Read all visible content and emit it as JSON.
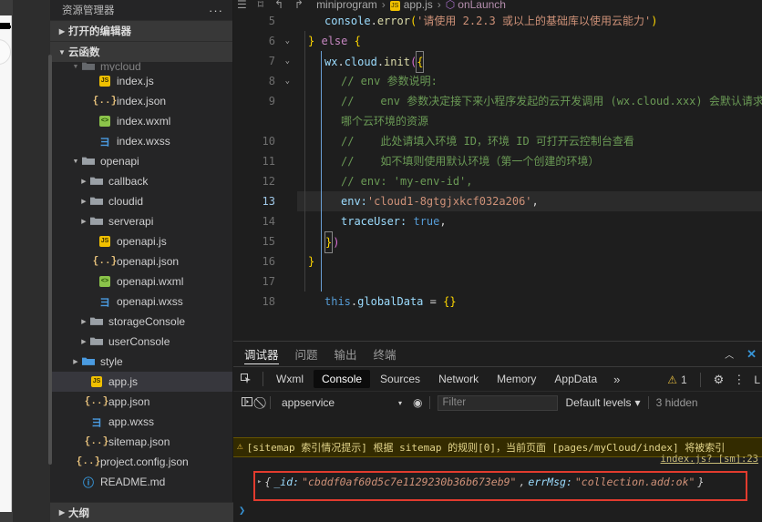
{
  "simulator": {
    "battery_icon": "battery-icon",
    "home_circle": "home-circle"
  },
  "sidebar": {
    "title": "资源管理器",
    "more_label": "···",
    "sections": [
      {
        "label": "打开的编辑器",
        "expanded": false
      },
      {
        "label": "云函数",
        "expanded": true
      }
    ],
    "outline_label": "大纲",
    "tree": [
      {
        "label": "mycloud",
        "icon": "folder-open-icon",
        "indent": 2,
        "arrow": "down",
        "type": "folder",
        "clipped": true
      },
      {
        "label": "index.js",
        "icon": "js-file-icon",
        "indent": 4,
        "arrow": "",
        "type": "file"
      },
      {
        "label": "index.json",
        "icon": "json-file-icon",
        "indent": 4,
        "arrow": "",
        "type": "file"
      },
      {
        "label": "index.wxml",
        "icon": "wxml-file-icon",
        "indent": 4,
        "arrow": "",
        "type": "file"
      },
      {
        "label": "index.wxss",
        "icon": "wxss-file-icon",
        "indent": 4,
        "arrow": "",
        "type": "file"
      },
      {
        "label": "openapi",
        "icon": "folder-open-icon",
        "indent": 2,
        "arrow": "down",
        "type": "folder"
      },
      {
        "label": "callback",
        "icon": "folder-icon",
        "indent": 3,
        "arrow": "right",
        "type": "folder"
      },
      {
        "label": "cloudid",
        "icon": "folder-icon",
        "indent": 3,
        "arrow": "right",
        "type": "folder"
      },
      {
        "label": "serverapi",
        "icon": "folder-icon",
        "indent": 3,
        "arrow": "right",
        "type": "folder"
      },
      {
        "label": "openapi.js",
        "icon": "js-file-icon",
        "indent": 4,
        "arrow": "",
        "type": "file"
      },
      {
        "label": "openapi.json",
        "icon": "json-file-icon",
        "indent": 4,
        "arrow": "",
        "type": "file"
      },
      {
        "label": "openapi.wxml",
        "icon": "wxml-file-icon",
        "indent": 4,
        "arrow": "",
        "type": "file"
      },
      {
        "label": "openapi.wxss",
        "icon": "wxss-file-icon",
        "indent": 4,
        "arrow": "",
        "type": "file"
      },
      {
        "label": "storageConsole",
        "icon": "folder-icon",
        "indent": 3,
        "arrow": "right",
        "type": "folder"
      },
      {
        "label": "userConsole",
        "icon": "folder-icon",
        "indent": 3,
        "arrow": "right",
        "type": "folder"
      },
      {
        "label": "style",
        "icon": "folder-blue-icon",
        "indent": 2,
        "arrow": "right",
        "type": "folder"
      },
      {
        "label": "app.js",
        "icon": "js-file-icon",
        "indent": 3,
        "arrow": "",
        "type": "file",
        "selected": true
      },
      {
        "label": "app.json",
        "icon": "json-file-icon",
        "indent": 3,
        "arrow": "",
        "type": "file"
      },
      {
        "label": "app.wxss",
        "icon": "wxss-file-icon",
        "indent": 3,
        "arrow": "",
        "type": "file"
      },
      {
        "label": "sitemap.json",
        "icon": "json-file-icon",
        "indent": 3,
        "arrow": "",
        "type": "file"
      },
      {
        "label": "project.config.json",
        "icon": "json-file-icon",
        "indent": 2,
        "arrow": "",
        "type": "file"
      },
      {
        "label": "README.md",
        "icon": "markdown-file-icon",
        "indent": 2,
        "arrow": "",
        "type": "file"
      }
    ]
  },
  "breadcrumb": {
    "part1": "miniprogram",
    "sep": "›",
    "part2": "app.js",
    "part3": "onLaunch",
    "icons": [
      "menu-icon",
      "bookmark-icon",
      "back-arrow-icon",
      "forward-arrow-icon"
    ]
  },
  "editor": {
    "lines": [
      {
        "num": "5",
        "fold": "",
        "active": false,
        "highlight": false
      },
      {
        "num": "6",
        "fold": "down",
        "active": false,
        "highlight": false
      },
      {
        "num": "7",
        "fold": "down",
        "active": false,
        "highlight": false
      },
      {
        "num": "8",
        "fold": "down",
        "active": false,
        "highlight": false
      },
      {
        "num": "9",
        "fold": "",
        "active": false,
        "highlight": false
      },
      {
        "num": "",
        "fold": "",
        "active": false,
        "highlight": false
      },
      {
        "num": "10",
        "fold": "",
        "active": false,
        "highlight": false
      },
      {
        "num": "11",
        "fold": "",
        "active": false,
        "highlight": false
      },
      {
        "num": "12",
        "fold": "",
        "active": false,
        "highlight": false
      },
      {
        "num": "13",
        "fold": "",
        "active": true,
        "highlight": true
      },
      {
        "num": "14",
        "fold": "",
        "active": false,
        "highlight": false
      },
      {
        "num": "15",
        "fold": "",
        "active": false,
        "highlight": false
      },
      {
        "num": "16",
        "fold": "",
        "active": false,
        "highlight": false
      },
      {
        "num": "17",
        "fold": "",
        "active": false,
        "highlight": false
      },
      {
        "num": "18",
        "fold": "",
        "active": false,
        "highlight": false
      }
    ],
    "code": {
      "l5_obj": "console",
      "l5_dot": ".",
      "l5_fn": "error",
      "l5_open": "(",
      "l5_str": "'请使用 2.2.3 或以上的基础库以使用云能力'",
      "l5_close": ")",
      "l6_brace": "}",
      "l6_else": "else",
      "l6_open": "{",
      "l7_wx": "wx",
      "l7_d1": ".",
      "l7_cloud": "cloud",
      "l7_d2": ".",
      "l7_init": "init",
      "l7_paren": "(",
      "l7_brace": "{",
      "l8_comment": "// env 参数说明:",
      "l9_comment": "//    env 参数决定接下来小程序发起的云开发调用 (wx.cloud.xxx) 会默认请求到",
      "l9_wrap": "哪个云环境的资源",
      "l10_comment": "//    此处请填入环境 ID，环境 ID 可打开云控制台查看",
      "l11_comment": "//    如不填则使用默认环境（第一个创建的环境）",
      "l12_comment": "// env: 'my-env-id',",
      "l13_key": "env:",
      "l13_str": "'cloud1-8gtgjxkcf032a206'",
      "l13_comma": ",",
      "l14_key": "traceUser:",
      "l14_val": "true",
      "l14_comma": ",",
      "l15_brace": "}",
      "l15_paren": ")",
      "l16_brace": "}",
      "l18_this": "this",
      "l18_dot": ".",
      "l18_prop": "globalData",
      "l18_eq": "=",
      "l18_obj": "{}"
    }
  },
  "panel": {
    "tabs": [
      {
        "label": "调试器",
        "active": true
      },
      {
        "label": "问题",
        "active": false
      },
      {
        "label": "输出",
        "active": false
      },
      {
        "label": "终端",
        "active": false
      }
    ],
    "collapse_icon": "chevron-up-icon",
    "close_icon": "close-icon",
    "devtools_tabs": [
      {
        "label": "Wxml",
        "active": false
      },
      {
        "label": "Console",
        "active": true
      },
      {
        "label": "Sources",
        "active": false
      },
      {
        "label": "Network",
        "active": false
      },
      {
        "label": "Memory",
        "active": false
      },
      {
        "label": "AppData",
        "active": false
      }
    ],
    "more_tabs_icon": "chevron-double-right-icon",
    "warning_count": "1",
    "settings_icon": "gear-icon",
    "kebab_icon": "kebab-menu-icon",
    "console_toolbar": {
      "sidebar_toggle_icon": "console-sidebar-icon",
      "clear_icon": "clear-console-icon",
      "context": "appservice",
      "context_caret": "▾",
      "eye_icon": "live-expression-icon",
      "filter_placeholder": "Filter",
      "levels_label": "Default levels",
      "levels_caret": "▾",
      "hidden_label": "3 hidden"
    },
    "console_messages": [
      {
        "type": "warning",
        "icon": "warning-triangle-icon",
        "text": "[sitemap 索引情况提示] 根据 sitemap 的规则[0]，当前页面 [pages/myCloud/index] 将被索引",
        "source": "index.js? [sm]:23"
      }
    ],
    "result": {
      "expander": "▸",
      "open_brace": "{",
      "key1": "_id:",
      "val1": "\"cbddf0af60d5c7e1129230b36b673eb9\"",
      "comma": ",",
      "key2": "errMsg:",
      "val2": "\"collection.add:ok\"",
      "close_brace": "}",
      "highlight_color": "#e23b2e"
    },
    "prompt_caret": "❯"
  },
  "colors": {
    "editor_bg": "#1e1e1e",
    "sidebar_bg": "#252526",
    "accent_blue": "#3794d6",
    "warning_yellow": "#e2b93d",
    "warning_bg": "#332b00",
    "highlight_red": "#e23b2e",
    "selected_row": "#37373d"
  }
}
